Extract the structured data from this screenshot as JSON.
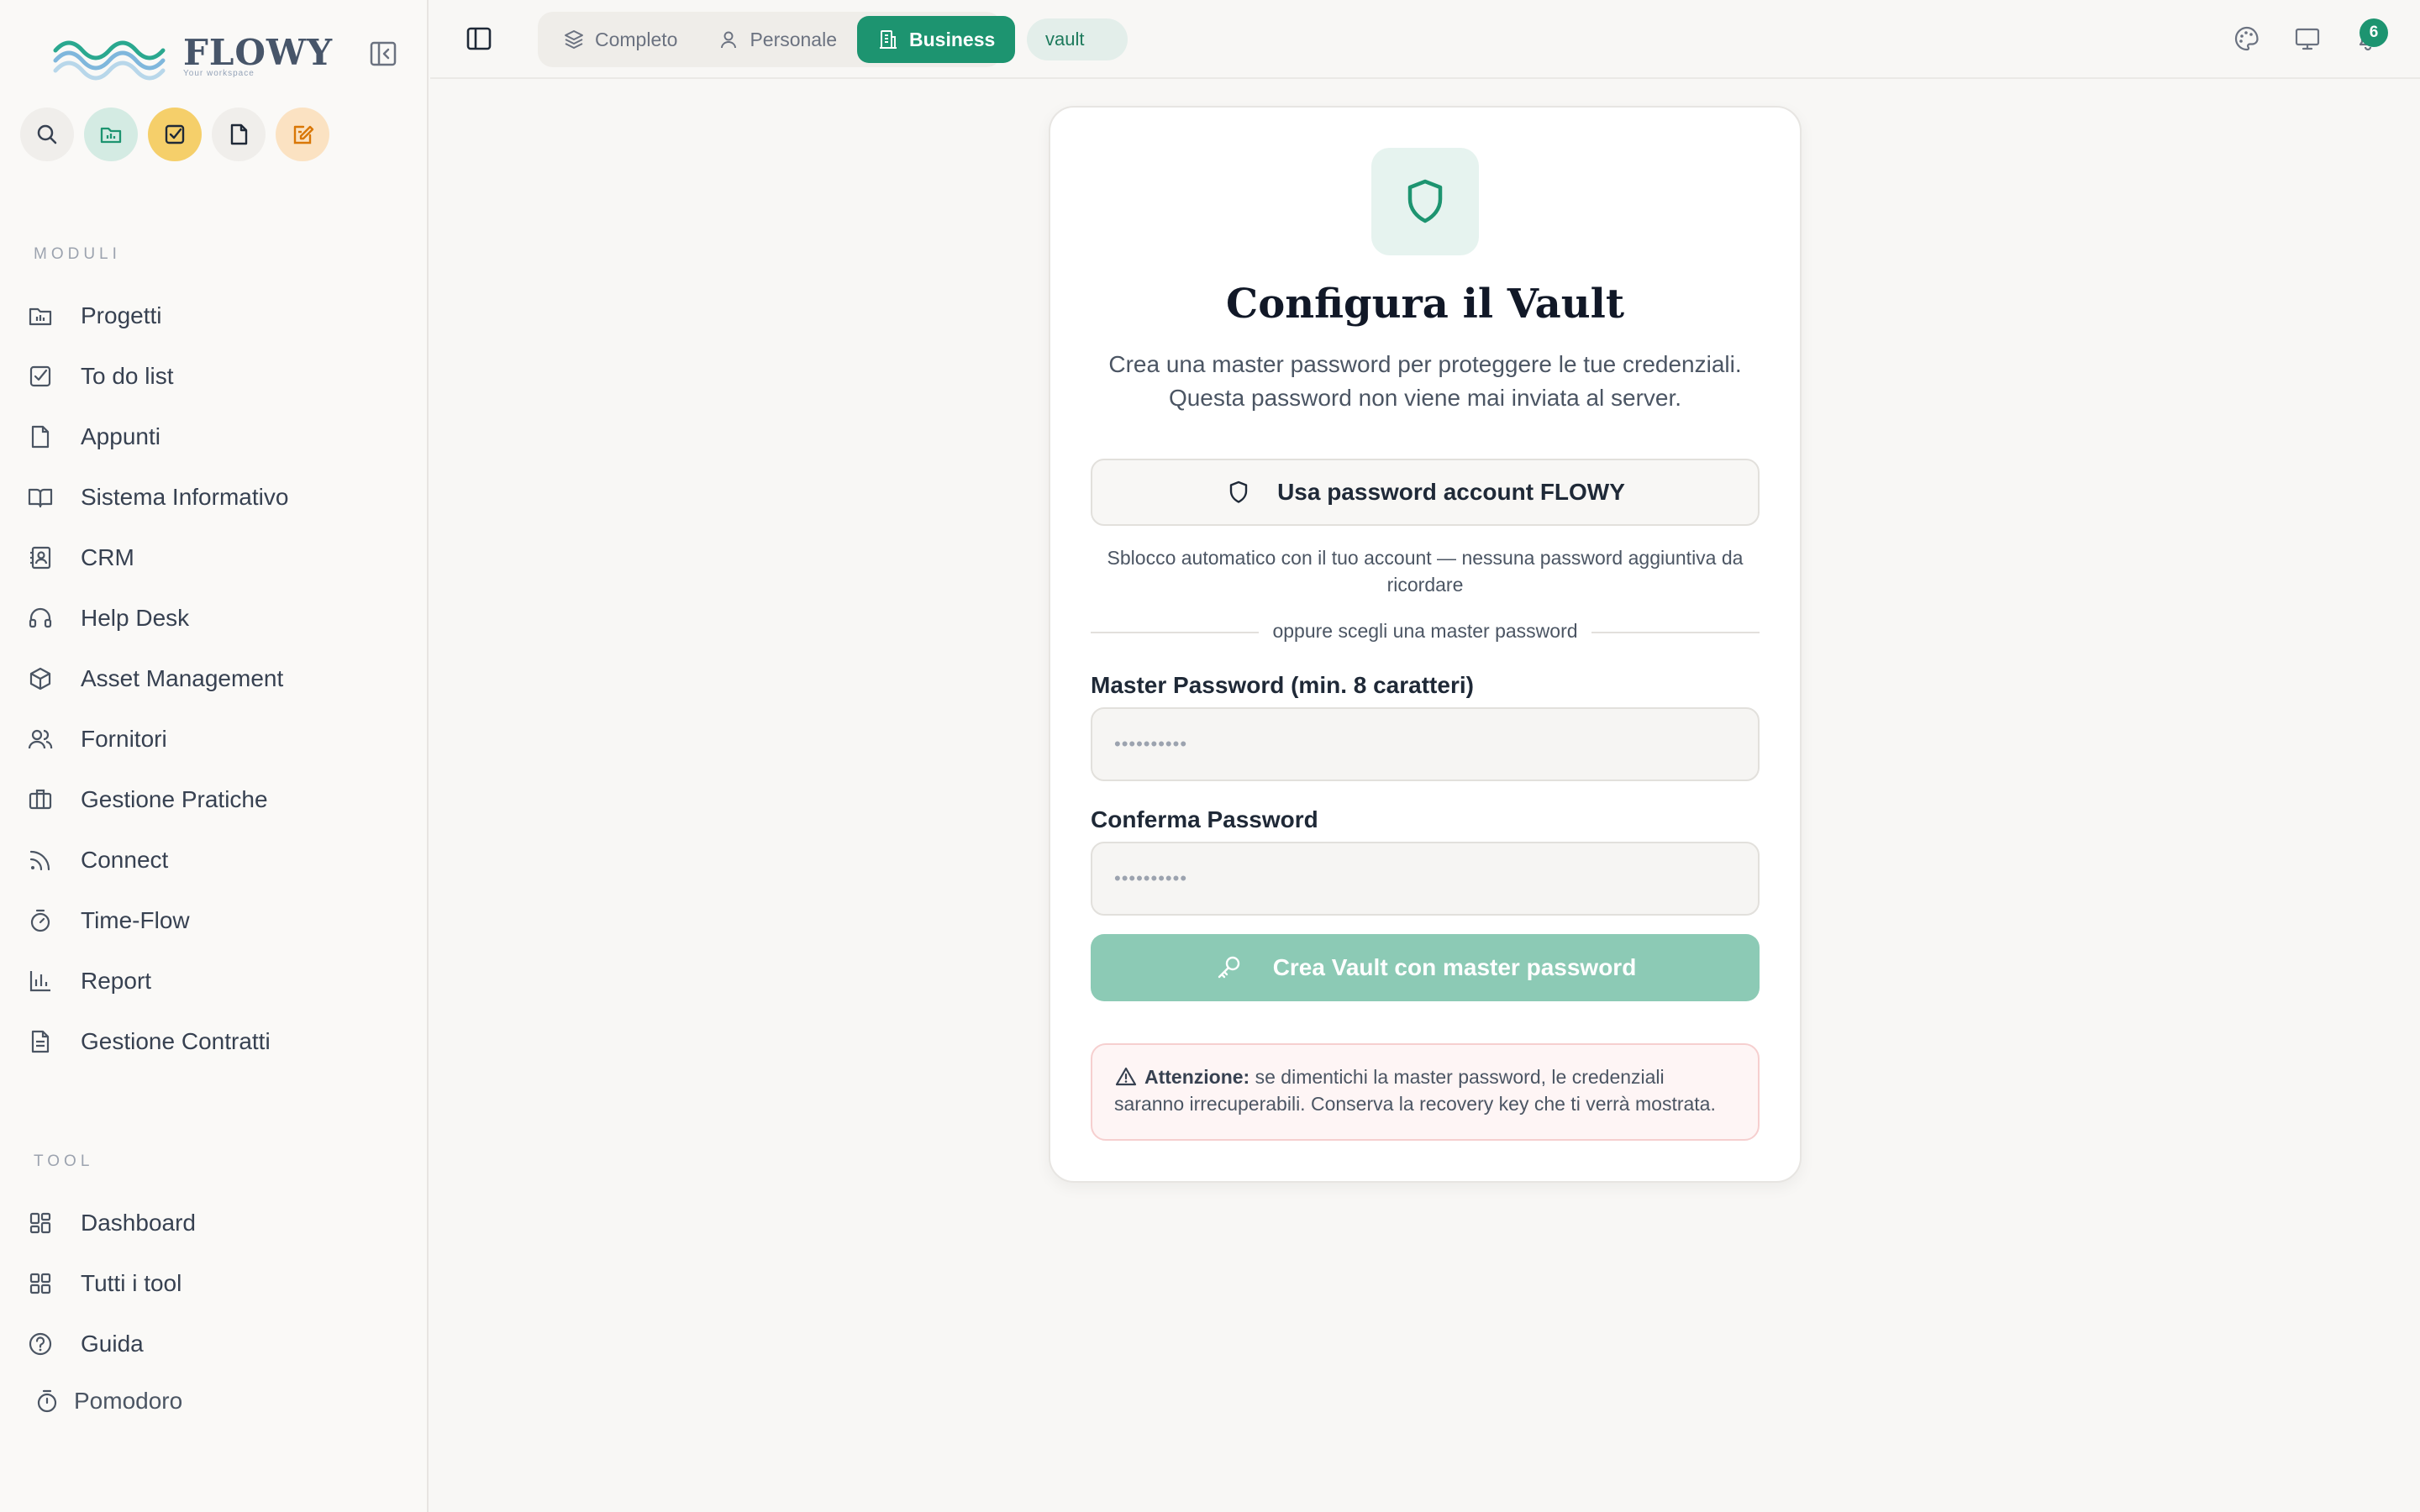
{
  "brand": {
    "name": "FLOWY",
    "tagline": "Your workspace"
  },
  "colors": {
    "accent": "#1d9470",
    "accent_light": "#8ccab5",
    "warning_bg": "#fef5f5"
  },
  "sidebar": {
    "quick_actions": [
      {
        "icon": "search-icon"
      },
      {
        "icon": "project-folder-icon"
      },
      {
        "icon": "checkbox-icon"
      },
      {
        "icon": "note-icon"
      },
      {
        "icon": "edit-note-icon"
      }
    ],
    "modules_label": "MODULI",
    "modules": [
      {
        "label": "Progetti",
        "icon": "folder-chart-icon"
      },
      {
        "label": "To do list",
        "icon": "checkbox-icon"
      },
      {
        "label": "Appunti",
        "icon": "file-icon"
      },
      {
        "label": "Sistema Informativo",
        "icon": "book-icon"
      },
      {
        "label": "CRM",
        "icon": "contacts-icon"
      },
      {
        "label": "Help Desk",
        "icon": "headset-icon"
      },
      {
        "label": "Asset Management",
        "icon": "box-icon"
      },
      {
        "label": "Fornitori",
        "icon": "users-icon"
      },
      {
        "label": "Gestione Pratiche",
        "icon": "briefcase-icon"
      },
      {
        "label": "Connect",
        "icon": "rss-icon"
      },
      {
        "label": "Time-Flow",
        "icon": "timer-icon"
      },
      {
        "label": "Report",
        "icon": "bar-chart-icon"
      },
      {
        "label": "Gestione Contratti",
        "icon": "document-icon"
      }
    ],
    "tools_label": "TOOL",
    "tools": [
      {
        "label": "Dashboard",
        "icon": "dashboard-icon"
      },
      {
        "label": "Tutti i tool",
        "icon": "grid-icon"
      },
      {
        "label": "Guida",
        "icon": "help-circle-icon"
      }
    ],
    "pomodoro": "Pomodoro"
  },
  "topbar": {
    "modes": [
      {
        "label": "Completo",
        "icon": "layers-icon",
        "active": false
      },
      {
        "label": "Personale",
        "icon": "user-icon",
        "active": false
      },
      {
        "label": "Business",
        "icon": "building-icon",
        "active": true
      }
    ],
    "context_chip": "vault",
    "notification_count": "6"
  },
  "vault": {
    "title": "Configura il Vault",
    "subtitle_line1": "Crea una master password per proteggere le tue credenziali.",
    "subtitle_line2": "Questa password non viene mai inviata al server.",
    "account_button": "Usa password account FLOWY",
    "account_hint": "Sblocco automatico con il tuo account — nessuna password aggiuntiva da ricordare",
    "divider": "oppure scegli una master password",
    "master_label": "Master Password (min. 8 caratteri)",
    "master_placeholder": "••••••••••",
    "confirm_label": "Conferma Password",
    "confirm_placeholder": "••••••••••",
    "create_button": "Crea Vault con master password",
    "warning_title": "Attenzione:",
    "warning_text": "se dimentichi la master password, le credenziali saranno irrecuperabili. Conserva la recovery key che ti verrà mostrata."
  }
}
